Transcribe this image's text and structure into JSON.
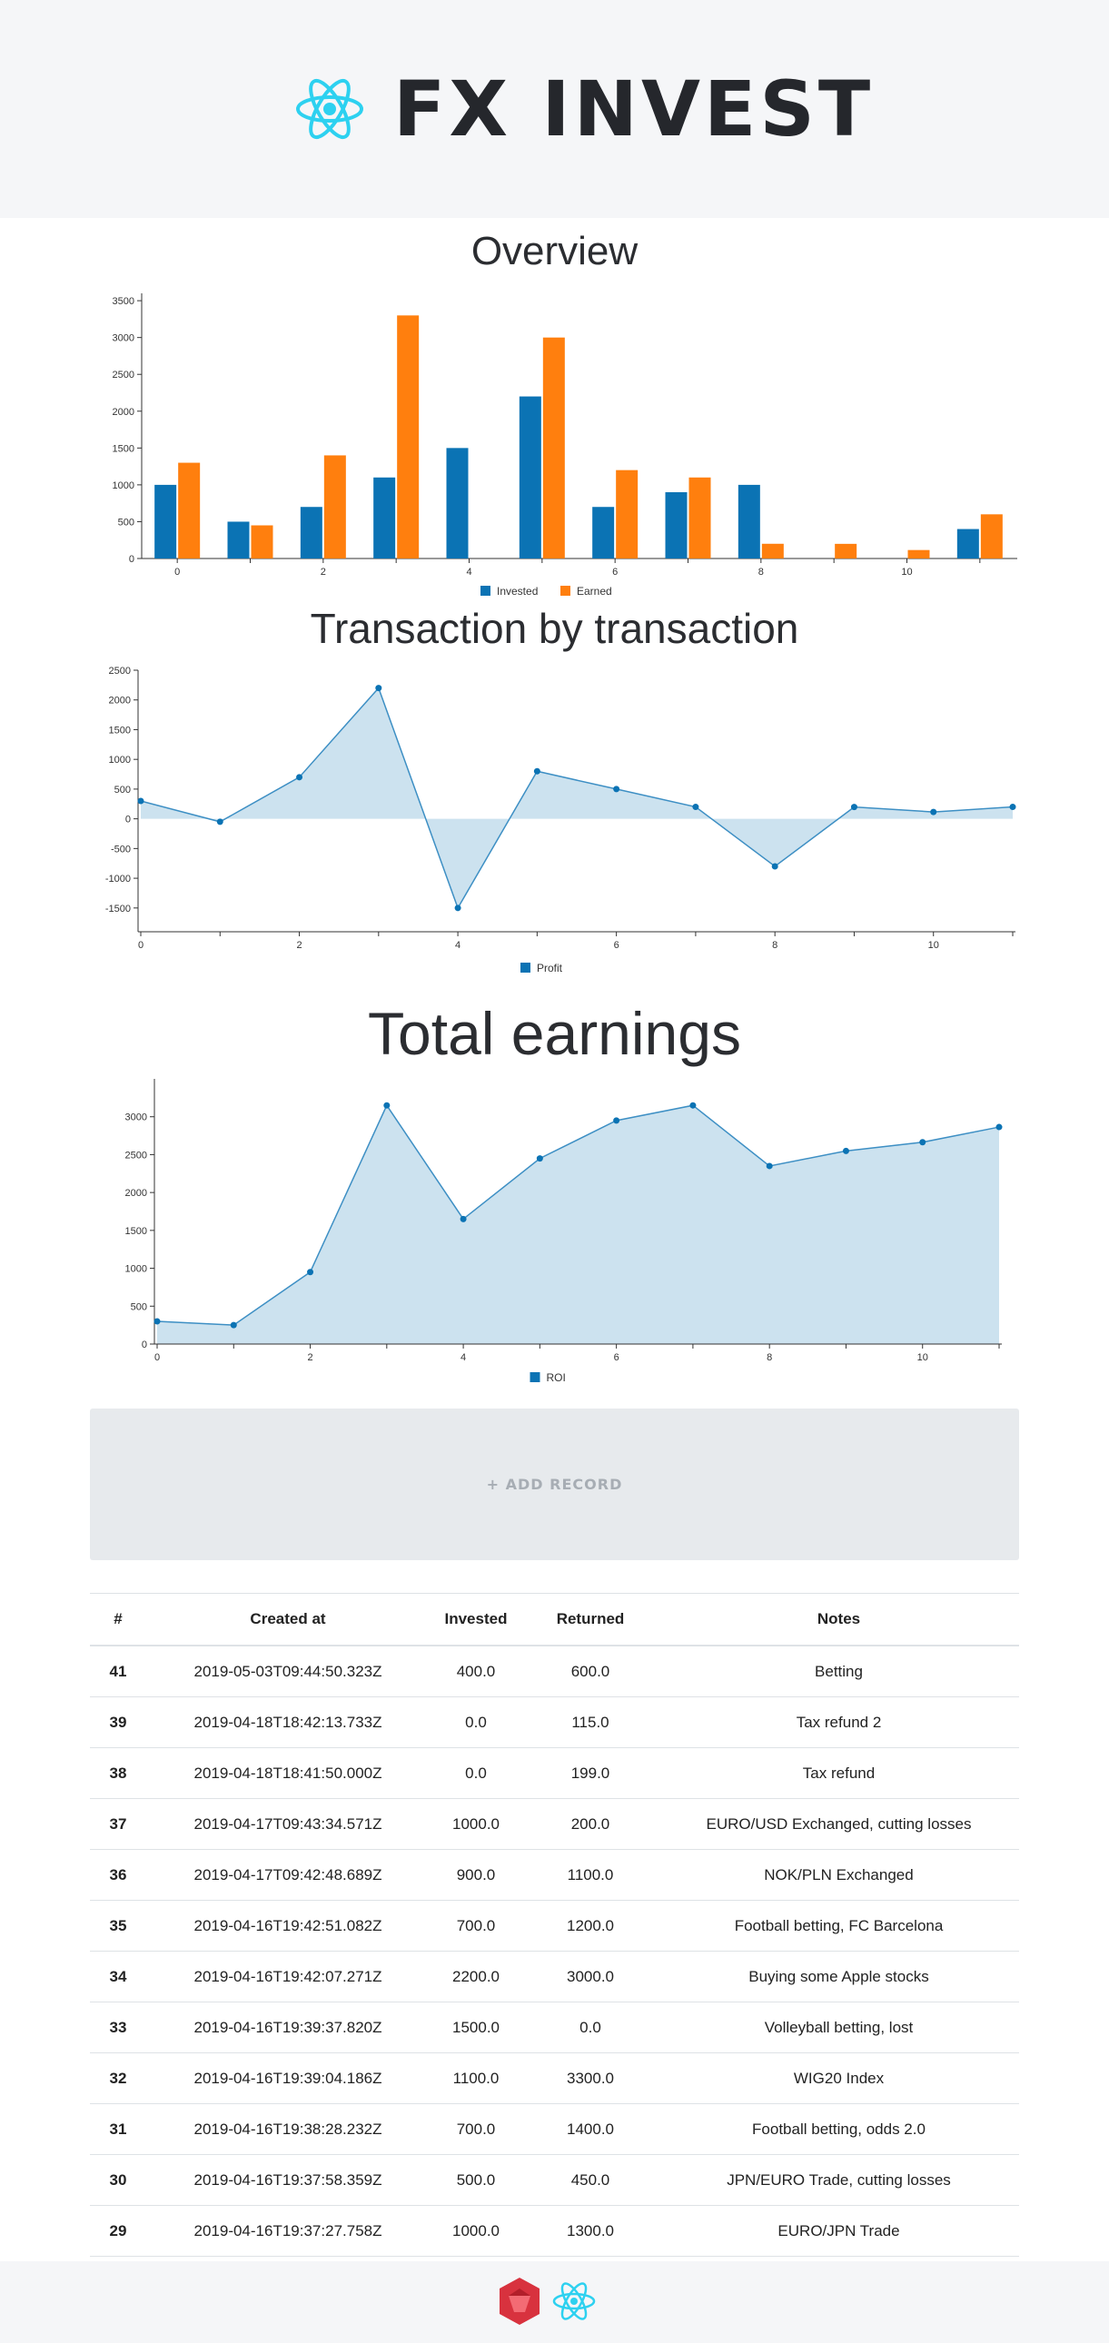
{
  "header": {
    "logo_text": "FX INVEST"
  },
  "sections": {
    "overview_title": "Overview",
    "transaction_title": "Transaction by transaction",
    "total_title": "Total earnings"
  },
  "add_record_label": "+ ADD RECORD",
  "table": {
    "headers": [
      "#",
      "Created at",
      "Invested",
      "Returned",
      "Notes"
    ],
    "rows": [
      {
        "id": "41",
        "created": "2019-05-03T09:44:50.323Z",
        "invested": "400.0",
        "returned": "600.0",
        "notes": "Betting"
      },
      {
        "id": "39",
        "created": "2019-04-18T18:42:13.733Z",
        "invested": "0.0",
        "returned": "115.0",
        "notes": "Tax refund 2"
      },
      {
        "id": "38",
        "created": "2019-04-18T18:41:50.000Z",
        "invested": "0.0",
        "returned": "199.0",
        "notes": "Tax refund"
      },
      {
        "id": "37",
        "created": "2019-04-17T09:43:34.571Z",
        "invested": "1000.0",
        "returned": "200.0",
        "notes": "EURO/USD Exchanged, cutting losses"
      },
      {
        "id": "36",
        "created": "2019-04-17T09:42:48.689Z",
        "invested": "900.0",
        "returned": "1100.0",
        "notes": "NOK/PLN Exchanged"
      },
      {
        "id": "35",
        "created": "2019-04-16T19:42:51.082Z",
        "invested": "700.0",
        "returned": "1200.0",
        "notes": "Football betting, FC Barcelona"
      },
      {
        "id": "34",
        "created": "2019-04-16T19:42:07.271Z",
        "invested": "2200.0",
        "returned": "3000.0",
        "notes": "Buying some Apple stocks"
      },
      {
        "id": "33",
        "created": "2019-04-16T19:39:37.820Z",
        "invested": "1500.0",
        "returned": "0.0",
        "notes": "Volleyball betting, lost"
      },
      {
        "id": "32",
        "created": "2019-04-16T19:39:04.186Z",
        "invested": "1100.0",
        "returned": "3300.0",
        "notes": "WIG20 Index"
      },
      {
        "id": "31",
        "created": "2019-04-16T19:38:28.232Z",
        "invested": "700.0",
        "returned": "1400.0",
        "notes": "Football betting, odds 2.0"
      },
      {
        "id": "30",
        "created": "2019-04-16T19:37:58.359Z",
        "invested": "500.0",
        "returned": "450.0",
        "notes": "JPN/EURO Trade, cutting losses"
      },
      {
        "id": "29",
        "created": "2019-04-16T19:37:27.758Z",
        "invested": "1000.0",
        "returned": "1300.0",
        "notes": "EURO/JPN Trade"
      }
    ]
  },
  "colors": {
    "blue": "#0b73b4",
    "orange": "#ff7f0e",
    "area": "#cce2ef",
    "logo": "#2dd1f0",
    "footer_red": "#d8323e"
  },
  "icons": {
    "logo": "react-atom-icon",
    "footer": [
      "ruby-gem-icon",
      "react-atom-icon"
    ]
  },
  "chart_data": [
    {
      "type": "bar",
      "x": [
        0,
        1,
        2,
        3,
        4,
        5,
        6,
        7,
        8,
        9,
        10,
        11
      ],
      "series": [
        {
          "name": "Invested",
          "values": [
            1000,
            500,
            700,
            1100,
            1500,
            2200,
            700,
            900,
            1000,
            0,
            0,
            400
          ]
        },
        {
          "name": "Earned",
          "values": [
            1300,
            450,
            1400,
            3300,
            0,
            3000,
            1200,
            1100,
            200,
            199,
            115,
            600
          ]
        }
      ],
      "ylim": [
        0,
        3600
      ],
      "yticks": [
        0,
        500,
        1000,
        1500,
        2000,
        2500,
        3000,
        3500
      ],
      "xticks": [
        0,
        2,
        4,
        6,
        8,
        10
      ],
      "legend": "bottom-center"
    },
    {
      "type": "area",
      "x": [
        0,
        1,
        2,
        3,
        4,
        5,
        6,
        7,
        8,
        9,
        10,
        11
      ],
      "series": [
        {
          "name": "Profit",
          "values": [
            300,
            -50,
            700,
            2200,
            -1500,
            800,
            500,
            200,
            -800,
            199,
            115,
            200
          ]
        }
      ],
      "ylim": [
        -1900,
        2500
      ],
      "yticks": [
        -1500,
        -1000,
        -500,
        0,
        500,
        1000,
        1500,
        2000,
        2500
      ],
      "xticks": [
        0,
        2,
        4,
        6,
        8,
        10
      ],
      "legend": "bottom-center"
    },
    {
      "type": "area",
      "x": [
        0,
        1,
        2,
        3,
        4,
        5,
        6,
        7,
        8,
        9,
        10,
        11
      ],
      "series": [
        {
          "name": "ROI",
          "values": [
            300,
            250,
            950,
            3150,
            1650,
            2450,
            2950,
            3150,
            2350,
            2549,
            2664,
            2864
          ]
        }
      ],
      "ylim": [
        0,
        3500
      ],
      "yticks": [
        0,
        500,
        1000,
        1500,
        2000,
        2500,
        3000
      ],
      "xticks": [
        0,
        2,
        4,
        6,
        8,
        10
      ],
      "legend": "bottom-center"
    }
  ]
}
